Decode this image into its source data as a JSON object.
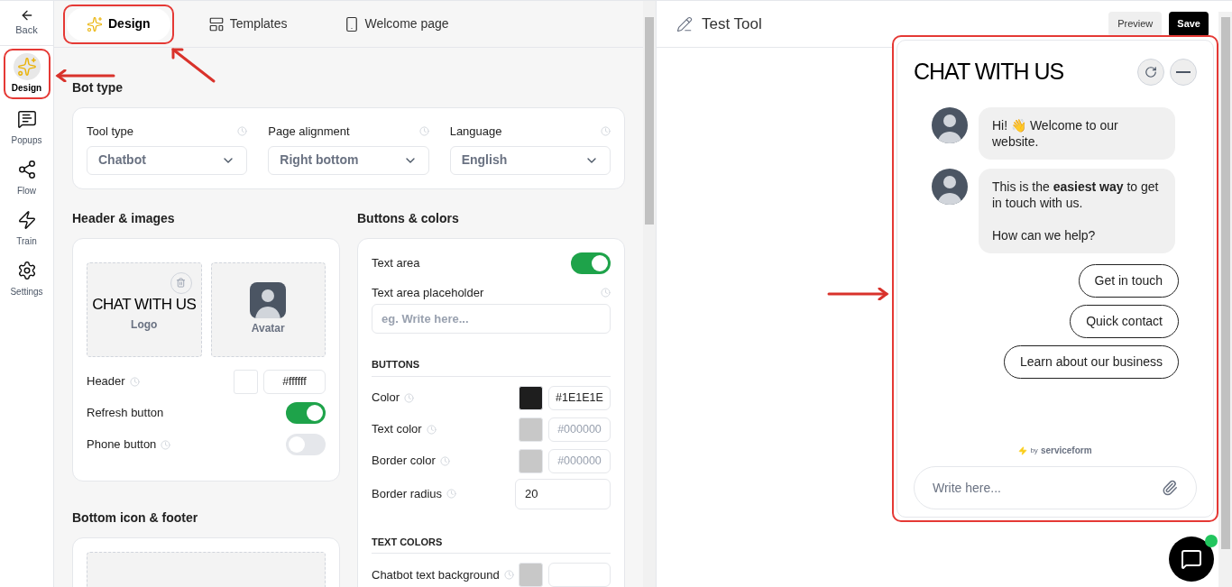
{
  "sidebar": {
    "back": {
      "label": "Back"
    },
    "items": [
      {
        "label": "Design",
        "selected": true,
        "annotated": true
      },
      {
        "label": "Popups",
        "selected": false,
        "annotated": false
      },
      {
        "label": "Flow",
        "selected": false,
        "annotated": false
      },
      {
        "label": "Train",
        "selected": false,
        "annotated": false
      },
      {
        "label": "Settings",
        "selected": false,
        "annotated": false
      }
    ]
  },
  "tabs": [
    {
      "label": "Design",
      "selected": true,
      "annotated": true
    },
    {
      "label": "Templates",
      "selected": false,
      "annotated": false
    },
    {
      "label": "Welcome page",
      "selected": false,
      "annotated": false
    }
  ],
  "bot_type": {
    "title": "Bot type",
    "fields": [
      {
        "label": "Tool type",
        "value": "Chatbot"
      },
      {
        "label": "Page alignment",
        "value": "Right bottom"
      },
      {
        "label": "Language",
        "value": "English"
      }
    ]
  },
  "header_images": {
    "title": "Header & images",
    "logo": {
      "text": "CHAT WITH US",
      "caption": "Logo"
    },
    "avatar": {
      "caption": "Avatar"
    },
    "rows": [
      {
        "kind": "color",
        "label": "Header",
        "value": "#ffffff"
      },
      {
        "kind": "toggle",
        "label": "Refresh button",
        "on": true,
        "info": false
      },
      {
        "kind": "toggle",
        "label": "Phone button",
        "on": false,
        "info": true
      }
    ]
  },
  "bottom_footer": {
    "title": "Bottom icon & footer"
  },
  "buttons_colors": {
    "title": "Buttons & colors",
    "text_area": {
      "label": "Text area",
      "on": true
    },
    "placeholder_field": {
      "label": "Text area placeholder",
      "placeholder": "eg. Write here..."
    },
    "sections": [
      {
        "title": "BUTTONS",
        "rows": [
          {
            "kind": "color",
            "label": "Color",
            "value": "#1E1E1E"
          },
          {
            "kind": "color",
            "label": "Text color",
            "placeholder": "#000000"
          },
          {
            "kind": "color",
            "label": "Border color",
            "placeholder": "#000000"
          },
          {
            "kind": "number",
            "label": "Border radius",
            "value": "20"
          }
        ]
      },
      {
        "title": "TEXT COLORS",
        "rows": [
          {
            "kind": "color",
            "label": "Chatbot text background"
          }
        ]
      }
    ]
  },
  "preview": {
    "title": "Test Tool",
    "preview_button": "Preview",
    "save_button": "Save",
    "annotated": true,
    "chat": {
      "title": "CHAT WITH US",
      "messages": [
        {
          "paragraphs": [
            "Hi! 👋 Welcome to our website."
          ]
        },
        {
          "paragraphs": [
            "This is the **easiest way** to get in touch with us.",
            "How can we help?"
          ]
        }
      ],
      "quick_replies": [
        "Get in touch",
        "Quick contact",
        "Learn about our business"
      ],
      "footer": {
        "by": "by",
        "brand": "serviceform"
      },
      "input": {
        "placeholder": "Write here..."
      }
    },
    "launcher": {
      "online": true
    }
  }
}
